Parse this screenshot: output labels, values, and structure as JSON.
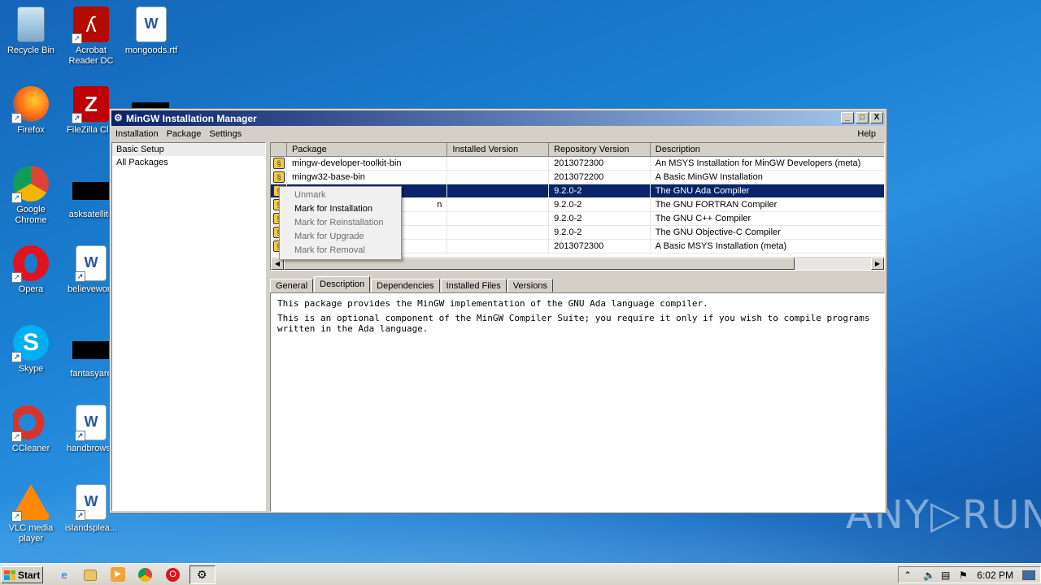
{
  "desktop_icons": [
    {
      "label": "Recycle Bin"
    },
    {
      "label": "Acrobat Reader DC"
    },
    {
      "label": "mongoods.rtf"
    },
    {
      "label": "Firefox"
    },
    {
      "label": "FileZilla Clie"
    },
    {
      "label": "Google Chrome"
    },
    {
      "label": "asksatellite"
    },
    {
      "label": "Opera"
    },
    {
      "label": "believework"
    },
    {
      "label": "Skype"
    },
    {
      "label": "fantasyare"
    },
    {
      "label": "CCleaner"
    },
    {
      "label": "handbrowse"
    },
    {
      "label": "VLC media player"
    },
    {
      "label": "islandsplea..."
    }
  ],
  "window": {
    "title": "MinGW Installation Manager",
    "controls": [
      "_",
      "□",
      "X"
    ],
    "menu": [
      "Installation",
      "Package",
      "Settings"
    ],
    "help": "Help"
  },
  "left_pane": {
    "items": [
      "Basic Setup",
      "All Packages"
    ]
  },
  "package_table": {
    "columns": [
      "Package",
      "Installed Version",
      "Repository Version",
      "Description"
    ],
    "rows": [
      {
        "package": "mingw-developer-toolkit-bin",
        "installed": "",
        "repo": "2013072300",
        "desc": "An MSYS Installation for MinGW Developers (meta)"
      },
      {
        "package": "mingw32-base-bin",
        "installed": "",
        "repo": "2013072200",
        "desc": "A Basic MinGW Installation"
      },
      {
        "package": "",
        "installed": "",
        "repo": "9.2.0-2",
        "desc": "The GNU Ada Compiler"
      },
      {
        "package": "n",
        "installed": "",
        "repo": "9.2.0-2",
        "desc": "The GNU FORTRAN Compiler"
      },
      {
        "package": "",
        "installed": "",
        "repo": "9.2.0-2",
        "desc": "The GNU C++ Compiler"
      },
      {
        "package": "",
        "installed": "",
        "repo": "9.2.0-2",
        "desc": "The GNU Objective-C Compiler"
      },
      {
        "package": "",
        "installed": "",
        "repo": "2013072300",
        "desc": "A Basic MSYS Installation (meta)"
      }
    ]
  },
  "context_menu": {
    "items": [
      "Unmark",
      "Mark for Installation",
      "Mark for Reinstallation",
      "Mark for Upgrade",
      "Mark for Removal"
    ]
  },
  "tabs": [
    "General",
    "Description",
    "Dependencies",
    "Installed Files",
    "Versions"
  ],
  "description": {
    "line1": "This package provides the MinGW implementation of the GNU Ada language compiler.",
    "line2": "This is an optional component of the MinGW Compiler Suite; you require it only if you wish to compile programs written in the Ada language."
  },
  "taskbar": {
    "start_label": "Start",
    "clock": "6:02 PM"
  },
  "watermark": "ANY▷RUN"
}
